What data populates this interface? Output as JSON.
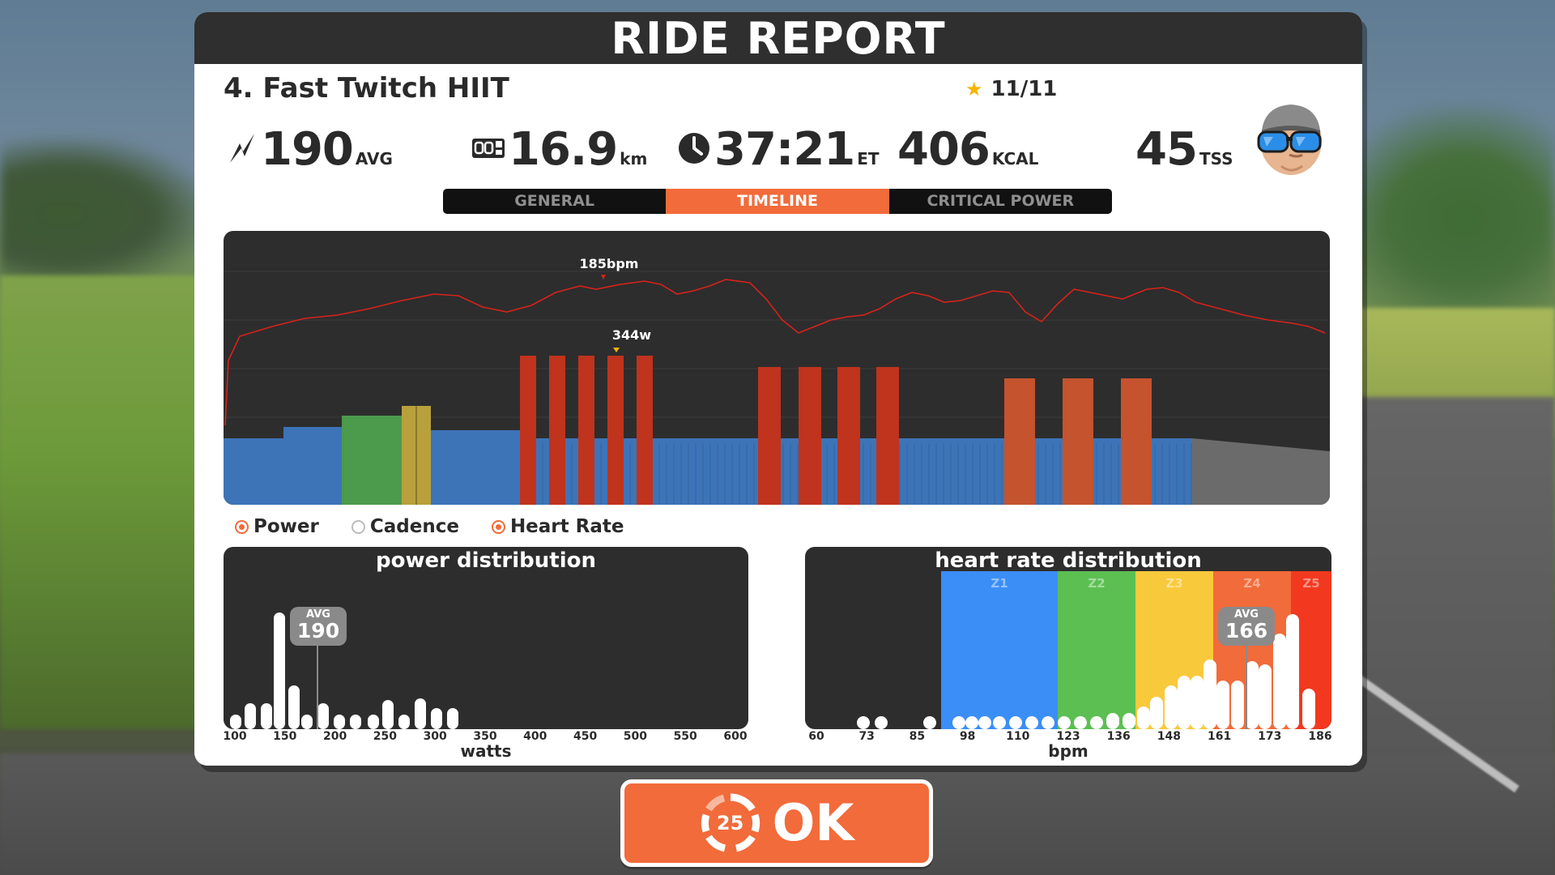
{
  "header": {
    "title": "RIDE REPORT"
  },
  "workout": {
    "title": "4. Fast Twitch HIIT",
    "stars": "11/11"
  },
  "stats": {
    "power": {
      "value": "190",
      "unit": "AVG"
    },
    "distance": {
      "value": "16.9",
      "unit": "km"
    },
    "time": {
      "value": "37:21",
      "unit": "ET"
    },
    "energy": {
      "value": "406",
      "unit": "KCAL"
    },
    "tss": {
      "value": "45",
      "unit": "TSS"
    }
  },
  "tabs": [
    {
      "label": "GENERAL",
      "active": false
    },
    {
      "label": "TIMELINE",
      "active": true
    },
    {
      "label": "CRITICAL POWER",
      "active": false
    }
  ],
  "timeline": {
    "hr_peak_label": "185bpm",
    "power_peak_label": "344w"
  },
  "legend": [
    {
      "label": "Power",
      "checked": true
    },
    {
      "label": "Cadence",
      "checked": false
    },
    {
      "label": "Heart Rate",
      "checked": true
    }
  ],
  "power_distribution": {
    "title": "power distribution",
    "xlabel": "watts",
    "avg_label": "AVG",
    "avg_value": "190",
    "ticks": [
      "100",
      "150",
      "200",
      "250",
      "300",
      "350",
      "400",
      "450",
      "500",
      "550",
      "600"
    ]
  },
  "hr_distribution": {
    "title": "heart rate distribution",
    "xlabel": "bpm",
    "avg_label": "AVG",
    "avg_value": "166",
    "ticks": [
      "60",
      "73",
      "85",
      "98",
      "110",
      "123",
      "136",
      "148",
      "161",
      "173",
      "186"
    ],
    "zones": [
      {
        "label": "Z1",
        "color": "#3a8ef6"
      },
      {
        "label": "Z2",
        "color": "#5cbf52"
      },
      {
        "label": "Z3",
        "color": "#f9c93c"
      },
      {
        "label": "Z4",
        "color": "#f26b3a"
      },
      {
        "label": "Z5",
        "color": "#f2391f"
      }
    ]
  },
  "ok_button": {
    "label": "OK",
    "countdown": "25"
  },
  "colors": {
    "accent": "#f26b3a",
    "zone_blue": "#3d74b8",
    "zone_green": "#4c9a4c",
    "zone_yellow": "#b8a03c",
    "zone_red": "#c0331d",
    "zone_orange": "#c4532e",
    "cooldown_gray": "#6b6b6b",
    "hr_line": "#d8221a"
  }
}
